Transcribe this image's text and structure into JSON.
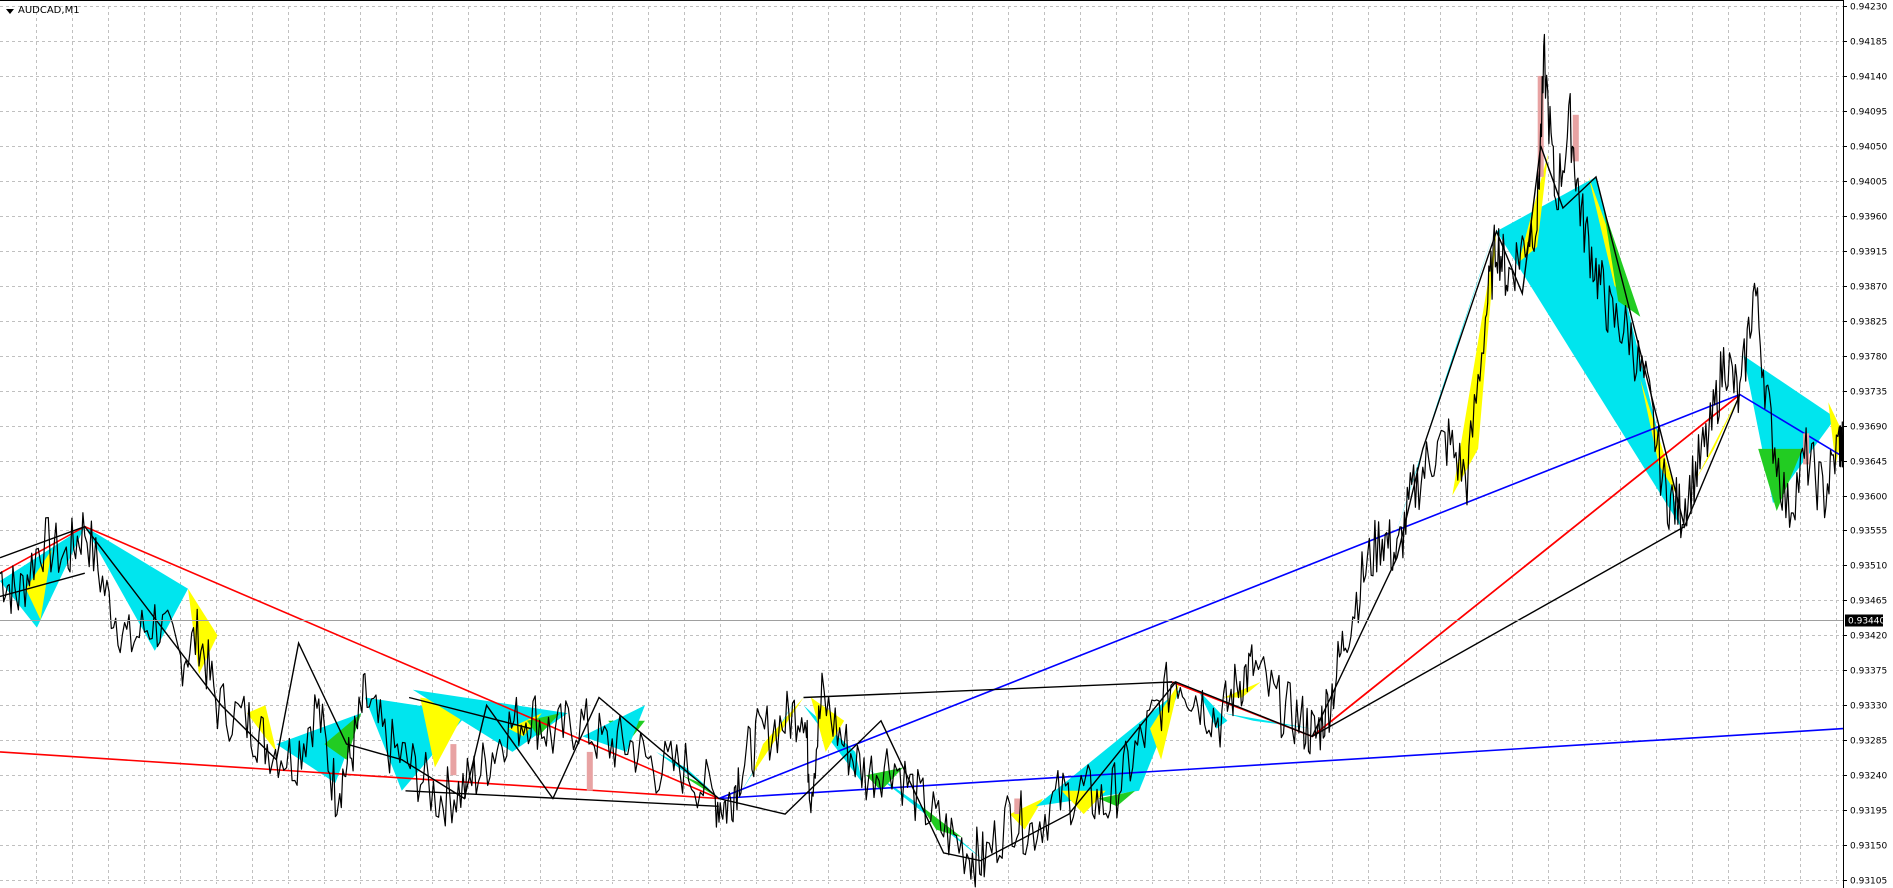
{
  "chart_title": "AUDCAD,M1",
  "symbol_menu_icon": "dropdown-triangle-icon",
  "colors": {
    "background": "#ffffff",
    "grid": "#c0c0c0",
    "price_line": "#000000",
    "bear_candle": "#e8a3a3",
    "zigzag_black": "#000000",
    "trend_red": "#ff0000",
    "trend_blue": "#0000ff",
    "fill_cyan": "#00e5ee",
    "fill_yellow": "#ffff00",
    "fill_green": "#22cc22",
    "current_price_bg": "#000000",
    "current_price_line": "#a0a0a0"
  },
  "current_price": "0.93440",
  "chart_data": {
    "type": "line",
    "symbol": "AUDCAD",
    "timeframe": "M1",
    "grid": true,
    "ylim": [
      0.931,
      0.9423
    ],
    "y_ticks": [
      "0.94230",
      "0.94185",
      "0.94140",
      "0.94095",
      "0.94050",
      "0.94005",
      "0.93960",
      "0.93915",
      "0.93870",
      "0.93825",
      "0.93780",
      "0.93735",
      "0.93690",
      "0.93645",
      "0.93600",
      "0.93555",
      "0.93510",
      "0.93465",
      "0.93420",
      "0.93375",
      "0.93330",
      "0.93285",
      "0.93240",
      "0.93195",
      "0.93150",
      "0.93105"
    ],
    "xlim": [
      0,
      1000
    ],
    "price_path": [
      [
        0,
        0.935
      ],
      [
        10,
        0.9347
      ],
      [
        22,
        0.9354
      ],
      [
        36,
        0.9352
      ],
      [
        46,
        0.9356
      ],
      [
        58,
        0.9347
      ],
      [
        70,
        0.9341
      ],
      [
        84,
        0.9344
      ],
      [
        98,
        0.9339
      ],
      [
        108,
        0.9342
      ],
      [
        118,
        0.9333
      ],
      [
        134,
        0.9331
      ],
      [
        145,
        0.9328
      ],
      [
        160,
        0.9326
      ],
      [
        172,
        0.9333
      ],
      [
        182,
        0.9322
      ],
      [
        190,
        0.9326
      ],
      [
        198,
        0.9334
      ],
      [
        210,
        0.9328
      ],
      [
        224,
        0.9325
      ],
      [
        238,
        0.9321
      ],
      [
        250,
        0.9322
      ],
      [
        262,
        0.9325
      ],
      [
        275,
        0.933
      ],
      [
        288,
        0.9332
      ],
      [
        300,
        0.9329
      ],
      [
        314,
        0.9331
      ],
      [
        328,
        0.9328
      ],
      [
        342,
        0.9328
      ],
      [
        356,
        0.9325
      ],
      [
        372,
        0.9325
      ],
      [
        388,
        0.9321
      ],
      [
        395,
        0.932
      ],
      [
        402,
        0.9325
      ],
      [
        412,
        0.9329
      ],
      [
        426,
        0.9331
      ],
      [
        436,
        0.9333
      ],
      [
        440,
        0.9322
      ],
      [
        446,
        0.9334
      ],
      [
        458,
        0.9328
      ],
      [
        470,
        0.9324
      ],
      [
        484,
        0.9326
      ],
      [
        498,
        0.9321
      ],
      [
        512,
        0.9317
      ],
      [
        526,
        0.9314
      ],
      [
        534,
        0.9313
      ],
      [
        548,
        0.9319
      ],
      [
        560,
        0.9317
      ],
      [
        574,
        0.9321
      ],
      [
        588,
        0.9322
      ],
      [
        600,
        0.932
      ],
      [
        612,
        0.9325
      ],
      [
        625,
        0.9331
      ],
      [
        638,
        0.9337
      ],
      [
        650,
        0.9334
      ],
      [
        662,
        0.9331
      ],
      [
        672,
        0.9336
      ],
      [
        680,
        0.9338
      ],
      [
        694,
        0.9333
      ],
      [
        706,
        0.9331
      ],
      [
        714,
        0.9329
      ],
      [
        722,
        0.9334
      ],
      [
        730,
        0.9342
      ],
      [
        740,
        0.935
      ],
      [
        750,
        0.9355
      ],
      [
        758,
        0.9352
      ],
      [
        766,
        0.936
      ],
      [
        776,
        0.9365
      ],
      [
        786,
        0.9367
      ],
      [
        796,
        0.9362
      ],
      [
        806,
        0.9383
      ],
      [
        812,
        0.9393
      ],
      [
        818,
        0.9388
      ],
      [
        826,
        0.9392
      ],
      [
        834,
        0.9396
      ],
      [
        838,
        0.9416
      ],
      [
        844,
        0.9398
      ],
      [
        852,
        0.9408
      ],
      [
        858,
        0.9396
      ],
      [
        866,
        0.9389
      ],
      [
        874,
        0.9383
      ],
      [
        884,
        0.9381
      ],
      [
        894,
        0.9373
      ],
      [
        904,
        0.936
      ],
      [
        912,
        0.9358
      ],
      [
        920,
        0.9363
      ],
      [
        928,
        0.9368
      ],
      [
        936,
        0.9378
      ],
      [
        944,
        0.9372
      ],
      [
        952,
        0.9387
      ],
      [
        960,
        0.937
      ],
      [
        970,
        0.9358
      ],
      [
        980,
        0.9365
      ],
      [
        990,
        0.936
      ],
      [
        998,
        0.9367
      ],
      [
        1000,
        0.9366
      ]
    ],
    "bear_candles": [
      [
        246,
        0.9324,
        0.9328
      ],
      [
        320,
        0.9322,
        0.9327
      ],
      [
        552,
        0.9319,
        0.9321
      ],
      [
        836,
        0.9401,
        0.9414
      ],
      [
        855,
        0.9403,
        0.9409
      ],
      [
        980,
        0.9364,
        0.9368
      ]
    ],
    "zigzag_black": [
      [
        [
          0,
          0.9352
        ],
        [
          46,
          0.9356
        ],
        [
          120,
          0.9333
        ],
        [
          150,
          0.9326
        ],
        [
          162,
          0.9341
        ],
        [
          188,
          0.9328
        ],
        [
          218,
          0.9326
        ],
        [
          252,
          0.9321
        ],
        [
          264,
          0.9333
        ],
        [
          300,
          0.9321
        ],
        [
          325,
          0.9334
        ],
        [
          390,
          0.9321
        ],
        [
          426,
          0.9319
        ],
        [
          478,
          0.9331
        ],
        [
          512,
          0.9314
        ],
        [
          532,
          0.9313
        ],
        [
          580,
          0.9319
        ],
        [
          638,
          0.9336
        ],
        [
          712,
          0.9329
        ],
        [
          758,
          0.9352
        ],
        [
          772,
          0.9366
        ],
        [
          812,
          0.9394
        ],
        [
          826,
          0.9386
        ],
        [
          836,
          0.9405
        ],
        [
          848,
          0.9397
        ],
        [
          866,
          0.9401
        ],
        [
          914,
          0.9356
        ],
        [
          944,
          0.9373
        ]
      ],
      [
        [
          0,
          0.9347
        ],
        [
          46,
          0.935
        ]
      ],
      [
        [
          220,
          0.9322
        ],
        [
          390,
          0.932
        ]
      ],
      [
        [
          436,
          0.9334
        ],
        [
          636,
          0.9336
        ]
      ],
      [
        [
          634,
          0.9336
        ],
        [
          636,
          0.9336
        ]
      ],
      [
        [
          712,
          0.9329
        ],
        [
          914,
          0.9356
        ]
      ],
      [
        [
          222,
          0.9334
        ],
        [
          288,
          0.933
        ]
      ]
    ],
    "trend_red": [
      [
        [
          0,
          0.935
        ],
        [
          46,
          0.9356
        ],
        [
          390,
          0.9321
        ]
      ],
      [
        [
          0,
          0.9327
        ],
        [
          390,
          0.9321
        ]
      ],
      [
        [
          636,
          0.9336
        ],
        [
          712,
          0.9329
        ],
        [
          944,
          0.9373
        ]
      ],
      [
        [
          712,
          0.9329
        ],
        [
          944,
          0.9373
        ]
      ]
    ],
    "trend_blue": [
      [
        [
          390,
          0.9321
        ],
        [
          944,
          0.9373
        ],
        [
          1000,
          0.9365
        ]
      ],
      [
        [
          390,
          0.9321
        ],
        [
          1000,
          0.933
        ]
      ]
    ],
    "fills": [
      {
        "color": "cyan",
        "points": [
          [
            0,
            0.9349
          ],
          [
            46,
            0.9356
          ],
          [
            20,
            0.9343
          ]
        ]
      },
      {
        "color": "yellow",
        "points": [
          [
            14,
            0.9348
          ],
          [
            28,
            0.9353
          ],
          [
            22,
            0.9344
          ]
        ]
      },
      {
        "color": "cyan",
        "points": [
          [
            46,
            0.9356
          ],
          [
            102,
            0.9348
          ],
          [
            84,
            0.934
          ]
        ]
      },
      {
        "color": "yellow",
        "points": [
          [
            102,
            0.9348
          ],
          [
            118,
            0.9342
          ],
          [
            108,
            0.9337
          ]
        ]
      },
      {
        "color": "yellow",
        "points": [
          [
            134,
            0.9332
          ],
          [
            150,
            0.9327
          ],
          [
            144,
            0.9333
          ]
        ]
      },
      {
        "color": "cyan",
        "points": [
          [
            150,
            0.9328
          ],
          [
            196,
            0.9332
          ],
          [
            182,
            0.9323
          ]
        ]
      },
      {
        "color": "green",
        "points": [
          [
            176,
            0.9328
          ],
          [
            196,
            0.9332
          ],
          [
            188,
            0.9326
          ]
        ]
      },
      {
        "color": "cyan",
        "points": [
          [
            198,
            0.9334
          ],
          [
            218,
            0.9322
          ],
          [
            254,
            0.9332
          ]
        ]
      },
      {
        "color": "yellow",
        "points": [
          [
            228,
            0.9334
          ],
          [
            254,
            0.9333
          ],
          [
            236,
            0.9325
          ]
        ]
      },
      {
        "color": "cyan",
        "points": [
          [
            224,
            0.9335
          ],
          [
            308,
            0.9332
          ],
          [
            278,
            0.9327
          ]
        ]
      },
      {
        "color": "yellow",
        "points": [
          [
            276,
            0.933
          ],
          [
            294,
            0.9332
          ],
          [
            284,
            0.9329
          ]
        ]
      },
      {
        "color": "green",
        "points": [
          [
            286,
            0.9331
          ],
          [
            304,
            0.9332
          ],
          [
            292,
            0.9329
          ]
        ]
      },
      {
        "color": "green",
        "points": [
          [
            330,
            0.9331
          ],
          [
            350,
            0.9331
          ],
          [
            340,
            0.9328
          ]
        ]
      },
      {
        "color": "cyan",
        "points": [
          [
            316,
            0.9329
          ],
          [
            350,
            0.9333
          ],
          [
            340,
            0.9327
          ]
        ]
      },
      {
        "color": "cyan",
        "points": [
          [
            356,
            0.9327
          ],
          [
            386,
            0.9322
          ],
          [
            372,
            0.9325
          ]
        ]
      },
      {
        "color": "green",
        "points": [
          [
            370,
            0.9324
          ],
          [
            390,
            0.9321
          ],
          [
            380,
            0.9323
          ]
        ]
      },
      {
        "color": "cyan",
        "points": [
          [
            400,
            0.9321
          ],
          [
            432,
            0.9334
          ],
          [
            418,
            0.9328
          ]
        ]
      },
      {
        "color": "yellow",
        "points": [
          [
            408,
            0.9324
          ],
          [
            436,
            0.9334
          ],
          [
            414,
            0.9328
          ]
        ]
      },
      {
        "color": "cyan",
        "points": [
          [
            436,
            0.9333
          ],
          [
            468,
            0.9323
          ],
          [
            464,
            0.9327
          ]
        ]
      },
      {
        "color": "yellow",
        "points": [
          [
            440,
            0.9334
          ],
          [
            458,
            0.9331
          ],
          [
            448,
            0.9327
          ]
        ]
      },
      {
        "color": "cyan",
        "points": [
          [
            470,
            0.9325
          ],
          [
            534,
            0.9313
          ],
          [
            500,
            0.932
          ]
        ]
      },
      {
        "color": "green",
        "points": [
          [
            470,
            0.9324
          ],
          [
            490,
            0.9325
          ],
          [
            478,
            0.9322
          ]
        ]
      },
      {
        "color": "green",
        "points": [
          [
            500,
            0.932
          ],
          [
            522,
            0.9316
          ],
          [
            508,
            0.9317
          ]
        ]
      },
      {
        "color": "yellow",
        "points": [
          [
            548,
            0.9319
          ],
          [
            566,
            0.9321
          ],
          [
            556,
            0.9317
          ]
        ]
      },
      {
        "color": "cyan",
        "points": [
          [
            562,
            0.932
          ],
          [
            640,
            0.9335
          ],
          [
            618,
            0.9322
          ]
        ]
      },
      {
        "color": "yellow",
        "points": [
          [
            576,
            0.9322
          ],
          [
            600,
            0.9322
          ],
          [
            588,
            0.9319
          ]
        ]
      },
      {
        "color": "green",
        "points": [
          [
            596,
            0.9321
          ],
          [
            616,
            0.9322
          ],
          [
            606,
            0.932
          ]
        ]
      },
      {
        "color": "yellow",
        "points": [
          [
            624,
            0.933
          ],
          [
            640,
            0.9336
          ],
          [
            630,
            0.9326
          ]
        ]
      },
      {
        "color": "cyan",
        "points": [
          [
            650,
            0.9335
          ],
          [
            666,
            0.9331
          ],
          [
            660,
            0.933
          ]
        ]
      },
      {
        "color": "yellow",
        "points": [
          [
            664,
            0.9334
          ],
          [
            684,
            0.9336
          ],
          [
            674,
            0.9334
          ]
        ]
      },
      {
        "color": "cyan",
        "points": [
          [
            664,
            0.9332
          ],
          [
            712,
            0.933
          ],
          [
            680,
            0.9331
          ]
        ]
      },
      {
        "color": "cyan",
        "points": [
          [
            756,
            0.9354
          ],
          [
            812,
            0.9395
          ],
          [
            780,
            0.9372
          ]
        ]
      },
      {
        "color": "yellow",
        "points": [
          [
            788,
            0.936
          ],
          [
            812,
            0.9394
          ],
          [
            802,
            0.9366
          ]
        ]
      },
      {
        "color": "cyan",
        "points": [
          [
            812,
            0.9394
          ],
          [
            866,
            0.9401
          ],
          [
            912,
            0.9356
          ]
        ]
      },
      {
        "color": "yellow",
        "points": [
          [
            824,
            0.939
          ],
          [
            840,
            0.9404
          ],
          [
            834,
            0.9392
          ]
        ]
      },
      {
        "color": "yellow",
        "points": [
          [
            862,
            0.9401
          ],
          [
            888,
            0.9384
          ],
          [
            876,
            0.9387
          ]
        ]
      },
      {
        "color": "green",
        "points": [
          [
            870,
            0.9397
          ],
          [
            890,
            0.9383
          ],
          [
            878,
            0.9385
          ]
        ]
      },
      {
        "color": "yellow",
        "points": [
          [
            890,
            0.9375
          ],
          [
            910,
            0.936
          ],
          [
            900,
            0.9364
          ]
        ]
      },
      {
        "color": "yellow",
        "points": [
          [
            920,
            0.9362
          ],
          [
            944,
            0.9373
          ],
          [
            930,
            0.9366
          ]
        ]
      },
      {
        "color": "cyan",
        "points": [
          [
            946,
            0.9378
          ],
          [
            996,
            0.937
          ],
          [
            962,
            0.9359
          ]
        ]
      },
      {
        "color": "green",
        "points": [
          [
            954,
            0.9366
          ],
          [
            978,
            0.9366
          ],
          [
            964,
            0.9358
          ]
        ]
      },
      {
        "color": "yellow",
        "points": [
          [
            992,
            0.9372
          ],
          [
            1000,
            0.9368
          ],
          [
            996,
            0.9364
          ]
        ]
      }
    ]
  }
}
